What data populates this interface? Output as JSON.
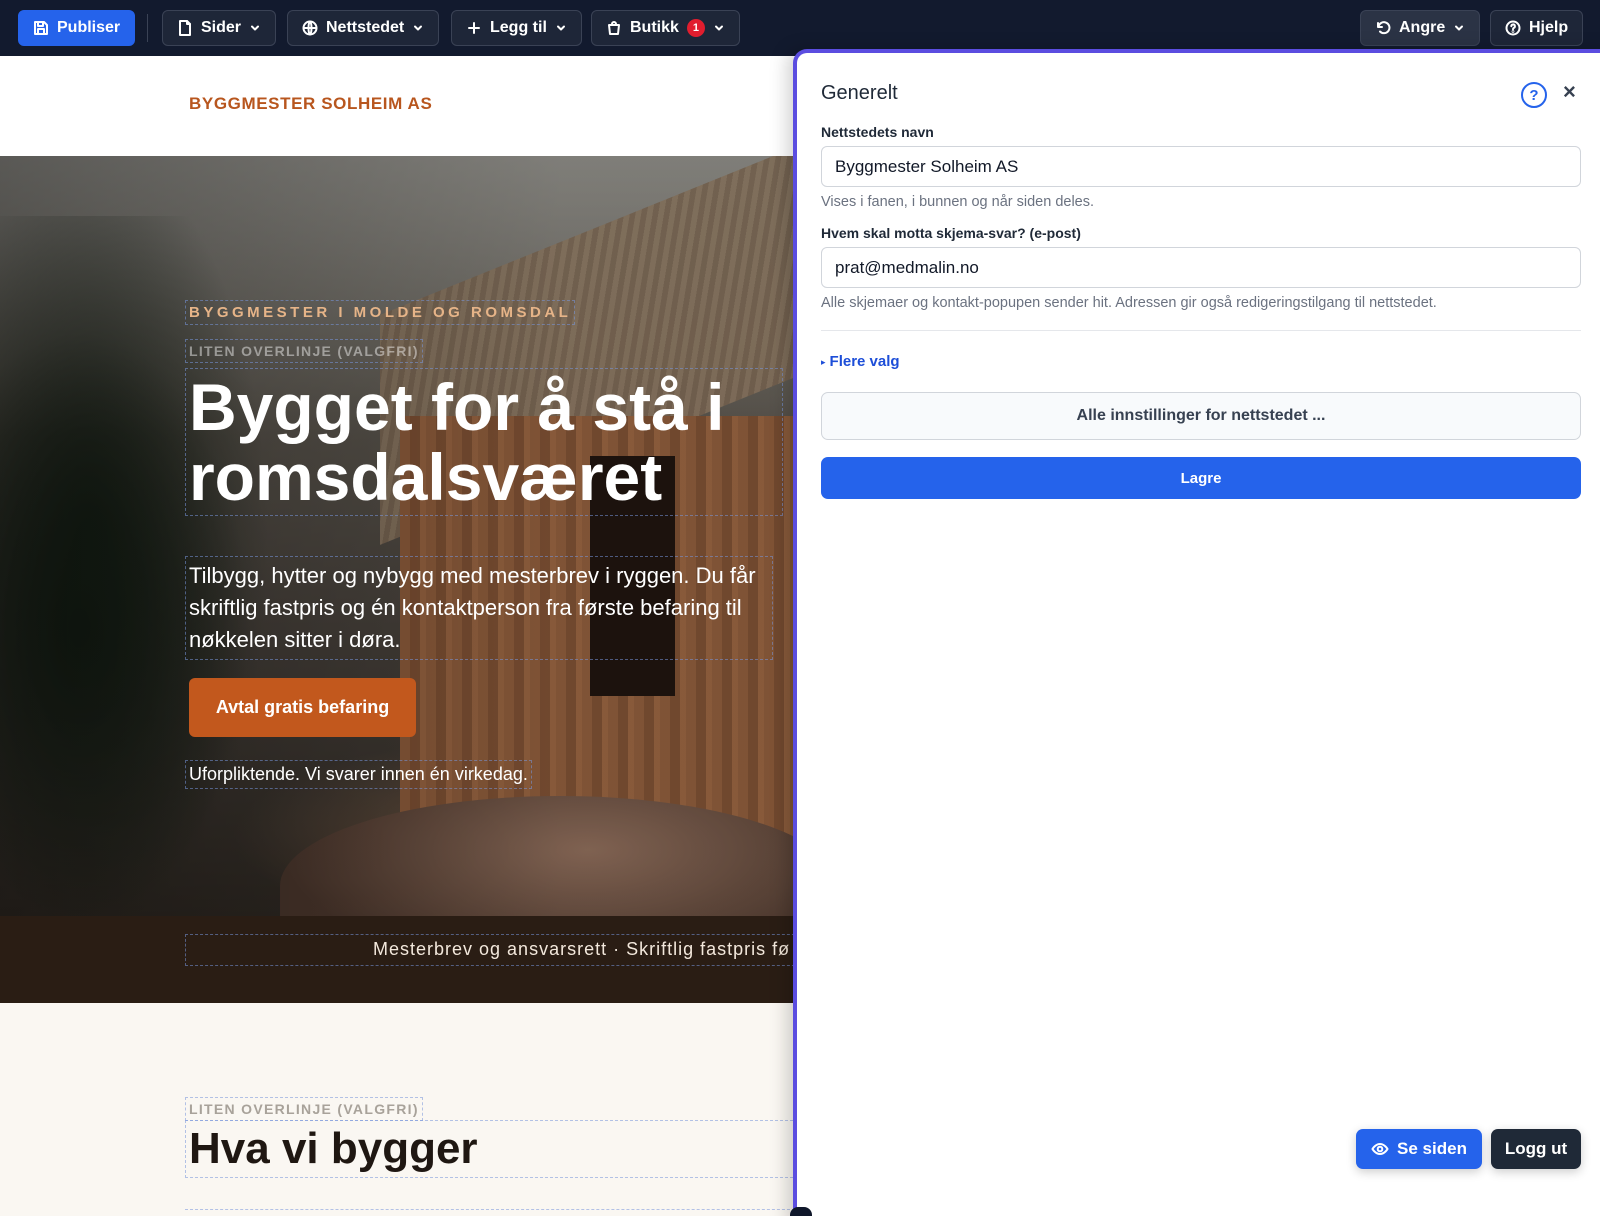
{
  "toolbar": {
    "publish": "Publiser",
    "pages": "Sider",
    "site": "Nettstedet",
    "add": "Legg til",
    "shop": "Butikk",
    "shop_badge": "1",
    "undo": "Angre",
    "help": "Hjelp"
  },
  "site": {
    "logo": "BYGGMESTER SOLHEIM AS",
    "hero": {
      "eyebrow": "BYGGMESTER I MOLDE OG ROMSDAL",
      "overline": "LITEN OVERLINJE (VALGFRI)",
      "title": "Bygget for å stå i romsdalsværet",
      "text": "Tilbygg, hytter og nybygg med mesterbrev i ryggen. Du får skriftlig fastpris og én kontaktperson fra første befaring til nøkkelen sitter i døra.",
      "cta": "Avtal gratis befaring",
      "note": "Uforpliktende. Vi svarer innen én virkedag."
    },
    "stripe": "Mesterbrev og ansvarsrett  ·  Skriftlig fastpris fø",
    "section": {
      "overline": "LITEN OVERLINJE (VALGFRI)",
      "title": "Hva vi bygger"
    }
  },
  "panel": {
    "title": "Generelt",
    "help_icon": "?",
    "close_icon": "×",
    "site_name_label": "Nettstedets navn",
    "site_name_value": "Byggmester Solheim AS",
    "site_name_hint": "Vises i fanen, i bunnen og når siden deles.",
    "email_label": "Hvem skal motta skjema-svar? (e-post)",
    "email_value": "prat@medmalin.no",
    "email_hint": "Alle skjemaer og kontakt-popupen sender hit. Adressen gir også redigeringstilgang til nettstedet.",
    "more_options": "Flere valg",
    "all_settings": "Alle innstillinger for nettstedet ...",
    "save": "Lagre"
  },
  "floating": {
    "view_site": "Se siden",
    "logout": "Logg ut"
  },
  "colors": {
    "toolbar_bg": "#121a2e",
    "primary": "#2563eb",
    "brand_orange": "#c2581d",
    "panel_border": "#5b4de0"
  }
}
